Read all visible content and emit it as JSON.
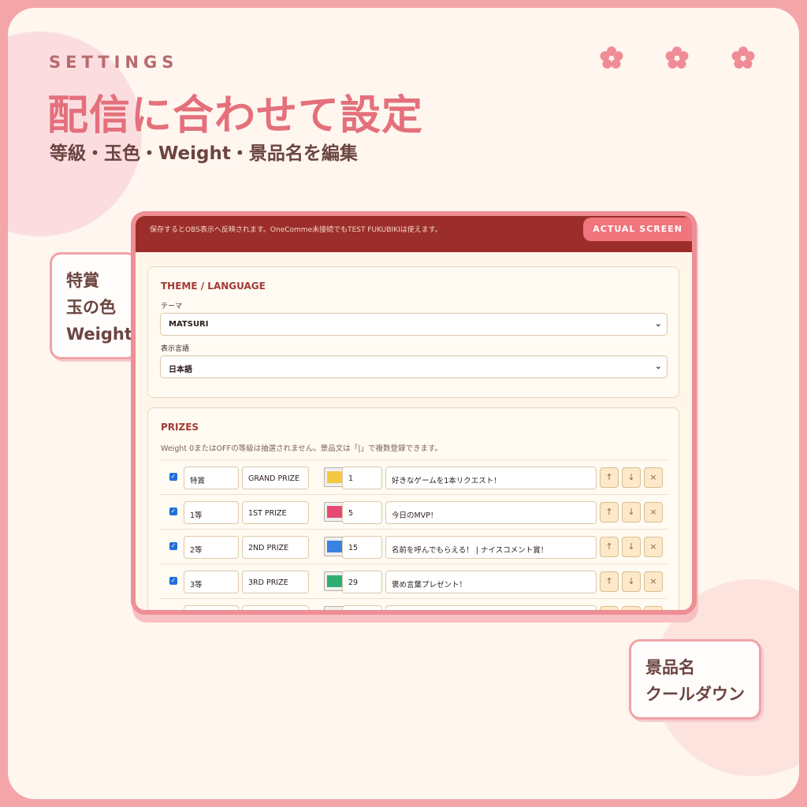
{
  "header": {
    "eyebrow": "SETTINGS",
    "headline": "配信に合わせて設定",
    "subline": "等級・玉色・Weight・景品名を編集"
  },
  "callouts": {
    "left": [
      "特賞",
      "玉の色",
      "Weight"
    ],
    "right": [
      "景品名",
      "クールダウン"
    ]
  },
  "screen": {
    "notice": "保存するとOBS表示へ反映されます。OneComme未接続でもTEST FUKUBIKIは使えます。",
    "badge": "ACTUAL SCREEN",
    "theme_panel": {
      "title": "THEME / LANGUAGE",
      "theme_label": "テーマ",
      "theme_value": "MATSURI",
      "lang_label": "表示言語",
      "lang_value": "日本語"
    },
    "prizes_panel": {
      "title": "PRIZES",
      "note": "Weight 0またはOFFの等級は抽選されません。景品文は「|」で複数登録できます。",
      "rows": [
        {
          "grade": "特賞",
          "name": "GRAND PRIZE",
          "color": "#f5c842",
          "weight": "1",
          "prize": "好きなゲームを1本リクエスト！"
        },
        {
          "grade": "1等",
          "name": "1ST PRIZE",
          "color": "#e84a6f",
          "weight": "5",
          "prize": "今日のMVP！"
        },
        {
          "grade": "2等",
          "name": "2ND PRIZE",
          "color": "#3b82e0",
          "weight": "15",
          "prize": "名前を呼んでもらえる！ | ナイスコメント賞！"
        },
        {
          "grade": "3等",
          "name": "3RD PRIZE",
          "color": "#2fae73",
          "weight": "29",
          "prize": "褒め言葉プレゼント！"
        },
        {
          "grade": "",
          "name": "",
          "color": "#e6e6e6",
          "weight": "",
          "prize": ""
        }
      ],
      "buttons": {
        "up": "↑",
        "down": "↓",
        "remove": "×"
      },
      "checkbox_mark": "✓"
    }
  },
  "colors": {
    "accent": "#e4707b",
    "bar": "#9b2e2a",
    "frame": "#f4a5a8"
  },
  "icons": [
    "sakura-icon",
    "sakura-icon",
    "sakura-icon",
    "chevron-down-icon",
    "checkbox-icon",
    "arrow-up-icon",
    "arrow-down-icon",
    "close-icon"
  ]
}
